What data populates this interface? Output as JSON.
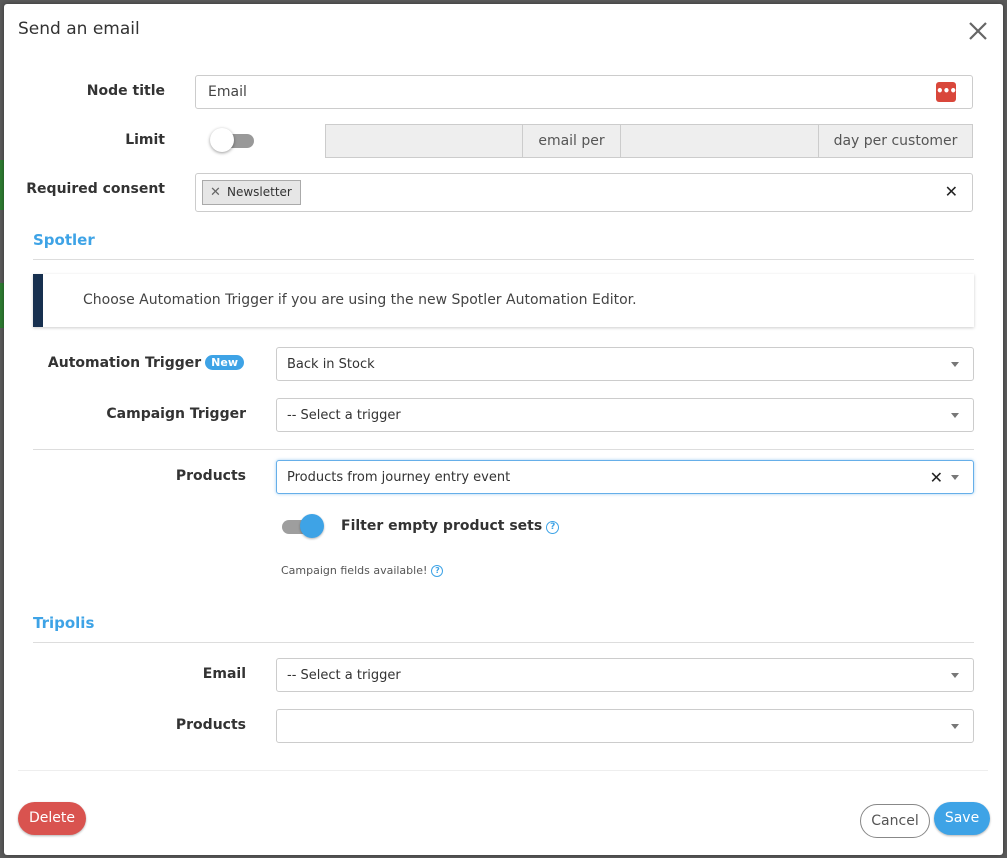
{
  "dialog": {
    "title": "Send an email"
  },
  "node_title": {
    "label": "Node title",
    "value": "Email",
    "dots": "•••"
  },
  "limit": {
    "label": "Limit",
    "enabled": false,
    "unit1": "email per",
    "unit2": "day per customer"
  },
  "consent": {
    "label": "Required consent",
    "tags": [
      "Newsletter"
    ],
    "clear": "✕"
  },
  "spotler": {
    "title": "Spotler",
    "notice": "Choose Automation Trigger if you are using the new Spotler Automation Editor.",
    "automation_trigger": {
      "label": "Automation Trigger",
      "badge": "New",
      "value": "Back in Stock"
    },
    "campaign_trigger": {
      "label": "Campaign Trigger",
      "value": "-- Select a trigger"
    },
    "products": {
      "label": "Products",
      "value": "Products from journey entry event",
      "clear": "✕"
    },
    "filter": {
      "label": "Filter empty product sets",
      "enabled": true
    },
    "campaign_fields": "Campaign fields available!",
    "help": "?"
  },
  "tripolis": {
    "title": "Tripolis",
    "email": {
      "label": "Email",
      "value": "-- Select a trigger"
    },
    "products": {
      "label": "Products",
      "value": ""
    }
  },
  "footer": {
    "delete": "Delete",
    "cancel": "Cancel",
    "save": "Save"
  },
  "colors": {
    "accent": "#3ea3e6",
    "danger": "#d9534f",
    "notice_bar": "#17304f"
  }
}
